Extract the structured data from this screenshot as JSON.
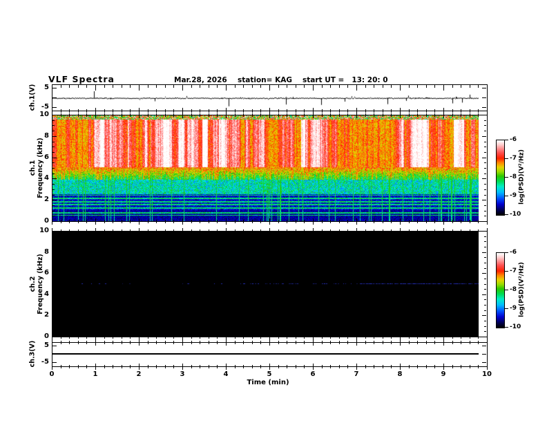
{
  "header": {
    "title": "VLF Spectra",
    "date": "Mar.28, 2026",
    "station": "station= KAG",
    "start_ut": "start UT =   13: 20: 0"
  },
  "axes": {
    "time": {
      "label": "Time (min)",
      "range": [
        0,
        10
      ],
      "major_ticks": [
        0,
        1,
        2,
        3,
        4,
        5,
        6,
        7,
        8,
        9,
        10
      ],
      "minor_step": 0.2
    },
    "ch1v": {
      "label": "ch.1(V)",
      "range": [
        -5,
        5
      ],
      "tick_values": [
        5,
        0,
        -5
      ],
      "tick_labels": [
        "5",
        "",
        "-5"
      ]
    },
    "ch1f": {
      "label_line1": "ch.1",
      "label_line2": "Frequency (kHz)",
      "range": [
        0,
        10
      ],
      "major_ticks": [
        0,
        2,
        4,
        6,
        8,
        10
      ],
      "minor_step": 0.5
    },
    "ch2f": {
      "label_line1": "ch.2",
      "label_line2": "Frequency (kHz)",
      "range": [
        0,
        10
      ],
      "major_ticks": [
        0,
        2,
        4,
        6,
        8,
        10
      ],
      "minor_step": 0.5
    },
    "ch3v": {
      "label": "ch.3(V)",
      "range": [
        -5,
        5
      ],
      "tick_values": [
        5,
        0,
        -5
      ],
      "tick_labels": [
        "5",
        "",
        "-5"
      ]
    }
  },
  "colorbars": [
    {
      "label": "log(PSD)(V²/Hz)",
      "ticks": [
        "-6",
        "-7",
        "-8",
        "-9",
        "-10"
      ],
      "range": [
        -10,
        -6
      ]
    },
    {
      "label": "log(PSD)(V²/Hz)",
      "ticks": [
        "-6",
        "-7",
        "-8",
        "-9",
        "-10"
      ],
      "range": [
        -10,
        -6
      ]
    }
  ],
  "render": {
    "seed": 1337,
    "data_end_min": 9.8,
    "palette": [
      [
        0.0,
        "#000006"
      ],
      [
        0.05,
        "#000042"
      ],
      [
        0.14,
        "#0000d0"
      ],
      [
        0.22,
        "#0055ff"
      ],
      [
        0.3,
        "#00bbff"
      ],
      [
        0.38,
        "#00eec8"
      ],
      [
        0.45,
        "#00dd55"
      ],
      [
        0.52,
        "#2cc800"
      ],
      [
        0.58,
        "#99dd00"
      ],
      [
        0.64,
        "#e8d400"
      ],
      [
        0.7,
        "#ff8800"
      ],
      [
        0.76,
        "#ff2200"
      ],
      [
        0.84,
        "#ff5555"
      ],
      [
        0.9,
        "#ff9b9b"
      ],
      [
        0.95,
        "#ffd4d4"
      ],
      [
        1.0,
        "#ffffff"
      ]
    ],
    "spec1": {
      "freq_max": 10,
      "top_speckle_band_khz": [
        9.62,
        10
      ],
      "white_red_zone_khz": [
        5.1,
        9.62
      ],
      "transition_zone_khz": [
        3.9,
        5.1
      ],
      "green_blue_zone_khz": [
        2.55,
        3.9
      ],
      "dark_blue_zone_khz": [
        1.02,
        2.55
      ],
      "black_zone_khz": [
        0,
        1.02
      ],
      "h_bands_khz": [
        0.55,
        0.8,
        1.25,
        1.55,
        1.85,
        2.15,
        2.45
      ],
      "pulse_density": 0.085
    },
    "spec2": {
      "background": "#000000",
      "line_freq_khz": 5,
      "line_color_rgb": [
        40,
        50,
        200
      ],
      "sparse_prob_left": 0.05,
      "mid_prob": 0.25,
      "dense_prob_right": 0.78
    },
    "ch1_wave": {
      "noise_v": 0.3,
      "spikes": [
        {
          "t": 0.95,
          "v": 3.6
        },
        {
          "t": 2.35,
          "v": -1.6
        },
        {
          "t": 4.05,
          "v": -4.2
        },
        {
          "t": 5.37,
          "v": -3.3
        },
        {
          "t": 6.18,
          "v": -3.5
        },
        {
          "t": 6.72,
          "v": -1.8
        },
        {
          "t": 7.7,
          "v": -3.1
        },
        {
          "t": 8.13,
          "v": -1.4
        },
        {
          "t": 9.2,
          "v": -2.7
        },
        {
          "t": 9.42,
          "v": -2.3
        },
        {
          "t": 9.6,
          "v": 1.8
        }
      ]
    },
    "ch3_value_v": 0
  },
  "chart_data": [
    {
      "type": "line",
      "title": "ch.1(V) voltage trace",
      "xlabel": "Time (min)",
      "ylabel": "ch.1(V)",
      "xlim": [
        0,
        10
      ],
      "ylim": [
        -5,
        5
      ],
      "data_extent_min": [
        0,
        9.8
      ],
      "description": "Dense noisy voltage signal centred on 0 V (±0.5 V) with sporadic impulsive spikes: ≈ +3.6 V near t=0.95 min and several −2 to −4 V spikes near t=4.05, 5.4, 6.2, 6.7, 7.7, 9.2 and 9.4 min."
    },
    {
      "type": "heatmap",
      "title": "ch.1 spectrogram",
      "xlabel": "Time (min)",
      "ylabel": "Frequency (kHz)",
      "zlabel": "log(PSD)(V²/Hz)",
      "xlim": [
        0,
        10
      ],
      "ylim": [
        0,
        10
      ],
      "zlim": [
        -10,
        -6
      ],
      "data_extent_min": [
        0,
        9.8
      ],
      "description": "Broadband VLF noise: intense PSD ≈ −6 to −7 (white/red with dense vertical striping) above ~5 kHz; multicoloured speckle band at 9.6–10 kHz; yellow/green/red chaotic transition 3.9–5.1 kHz; green/cyan/blue mix 2.5–3.9 kHz; dark blue 1–2.5 kHz with narrow horizontal enhancement lines near 0.55, 0.8, 1.25, 1.55, 1.85, 2.15 and 2.45 kHz; near-black below ~0.5 kHz; frequent vertical impulsive (sferic) lines reaching down to 0 kHz."
    },
    {
      "type": "heatmap",
      "title": "ch.2 spectrogram",
      "xlabel": "Time (min)",
      "ylabel": "Frequency (kHz)",
      "zlabel": "log(PSD)(V²/Hz)",
      "xlim": [
        0,
        10
      ],
      "ylim": [
        0,
        10
      ],
      "zlim": [
        -10,
        -6
      ],
      "data_extent_min": [
        0,
        9.8
      ],
      "description": "Essentially no signal (PSD ≈ −10, black everywhere) apart from a faint intermittent blue dashed line at 5 kHz that becomes denser after ~6.5 min."
    },
    {
      "type": "line",
      "title": "ch.3(V) voltage trace",
      "xlabel": "Time (min)",
      "ylabel": "ch.3(V)",
      "xlim": [
        0,
        10
      ],
      "ylim": [
        -5,
        5
      ],
      "data_extent_min": [
        0,
        9.8
      ],
      "description": "Constant flat line at 0 V for the whole record."
    }
  ]
}
